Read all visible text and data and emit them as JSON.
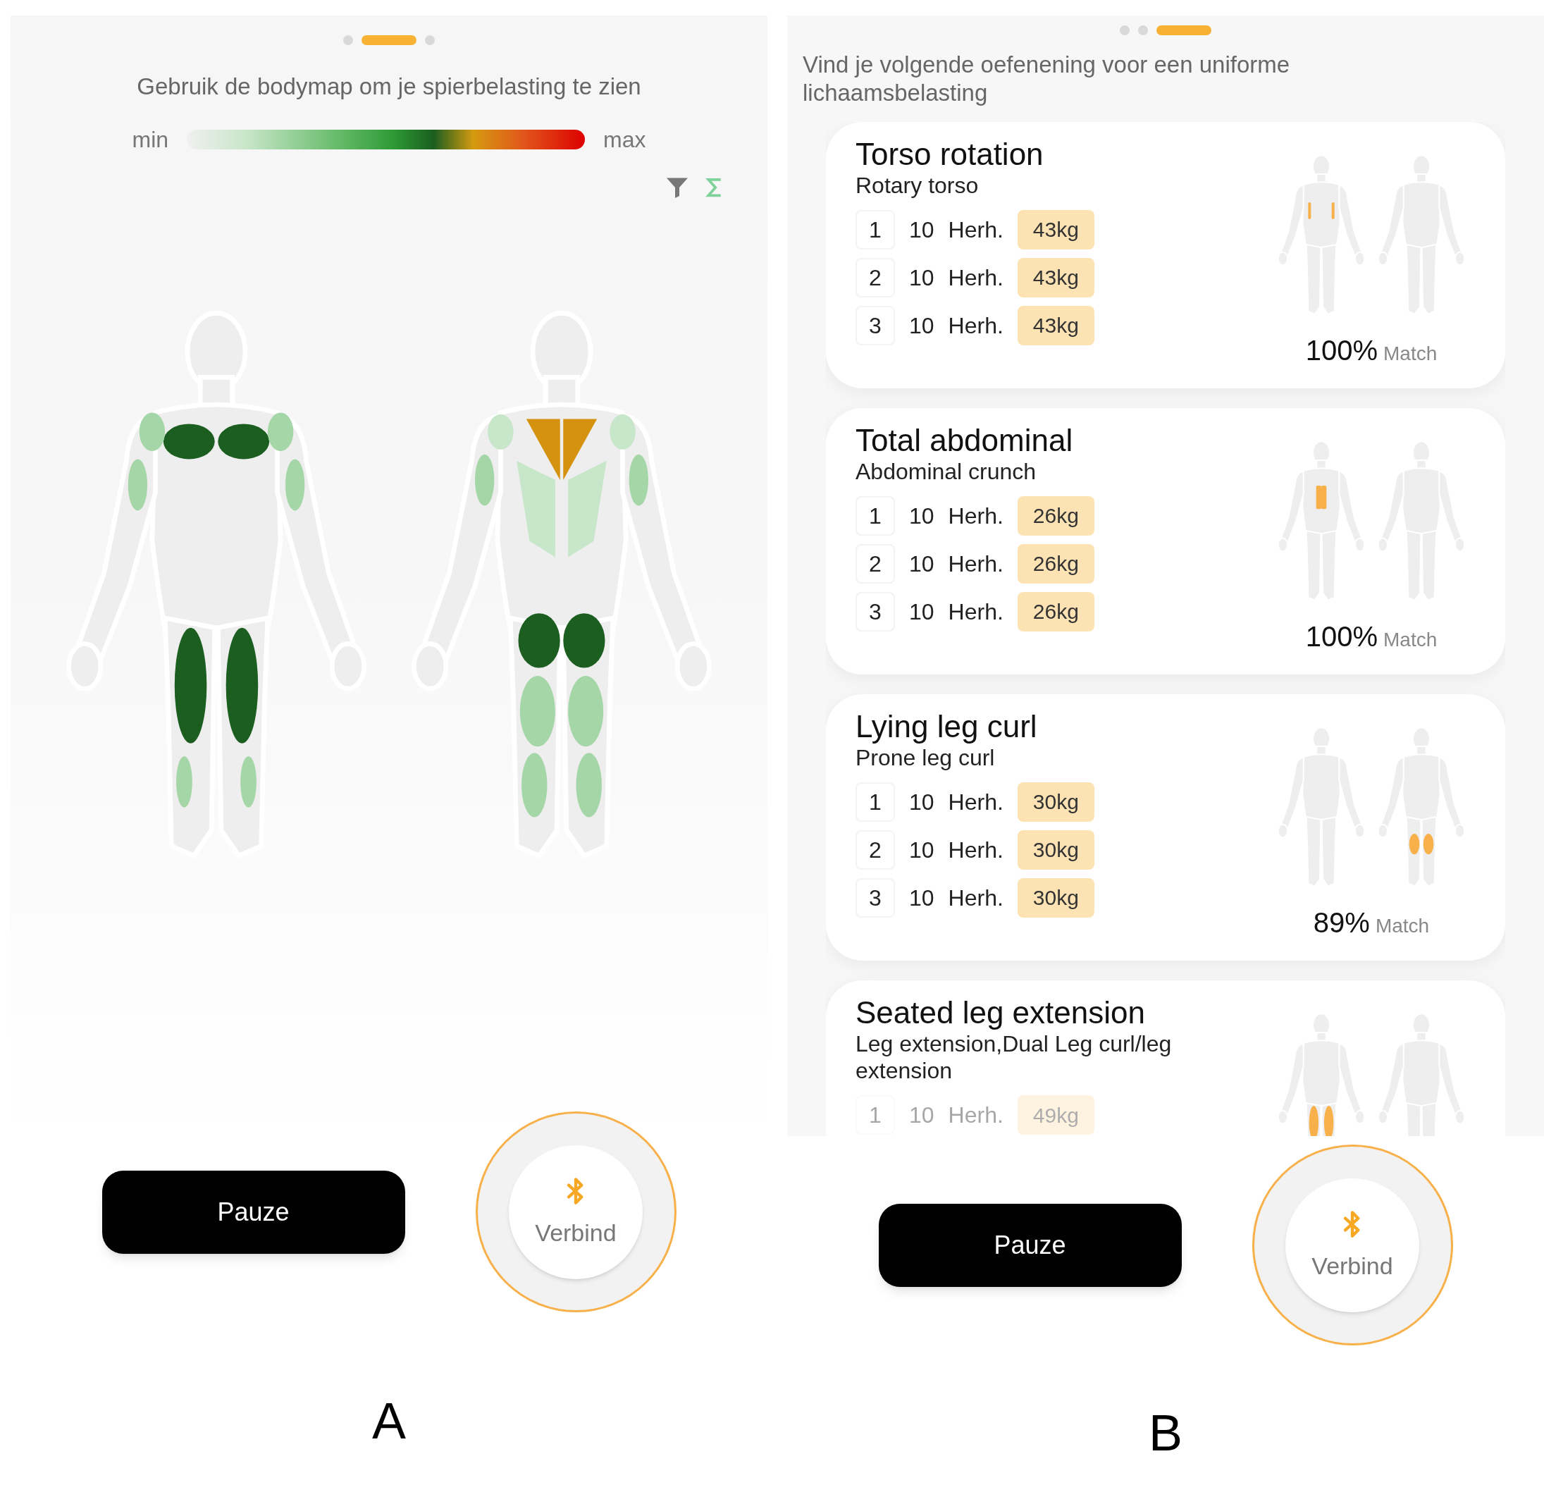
{
  "screens": [
    {
      "kind": "bodymap",
      "label": "A",
      "pager": [
        {
          "selected": false
        },
        {
          "selected": true
        },
        {
          "selected": false
        }
      ],
      "instruction": "Gebruik de bodymap om je spierbelasting te zien",
      "scale": {
        "min": "min",
        "max": "max"
      },
      "pause_button": "Pauze",
      "connect_button": "Verbind"
    },
    {
      "kind": "exercises",
      "label": "B",
      "pager": [
        {
          "selected": false
        },
        {
          "selected": false
        },
        {
          "selected": true
        }
      ],
      "instruction": "Vind je volgende oefenening voor een uniforme lichaamsbelasting",
      "exercises": [
        {
          "title": "Torso rotation",
          "subtitle": "Rotary torso",
          "kind": "obliques",
          "sets": [
            {
              "number": "1",
              "reps": "10",
              "unit": "Herh.",
              "weight": "43kg"
            },
            {
              "number": "2",
              "reps": "10",
              "unit": "Herh.",
              "weight": "43kg"
            },
            {
              "number": "3",
              "reps": "10",
              "unit": "Herh.",
              "weight": "43kg"
            }
          ],
          "match": "100%",
          "match_label": "Match"
        },
        {
          "title": "Total abdominal",
          "subtitle": "Abdominal crunch",
          "kind": "abs",
          "sets": [
            {
              "number": "1",
              "reps": "10",
              "unit": "Herh.",
              "weight": "26kg"
            },
            {
              "number": "2",
              "reps": "10",
              "unit": "Herh.",
              "weight": "26kg"
            },
            {
              "number": "3",
              "reps": "10",
              "unit": "Herh.",
              "weight": "26kg"
            }
          ],
          "match": "100%",
          "match_label": "Match"
        },
        {
          "title": "Lying leg curl",
          "subtitle": "Prone leg curl",
          "kind": "hamstrings",
          "sets": [
            {
              "number": "1",
              "reps": "10",
              "unit": "Herh.",
              "weight": "30kg"
            },
            {
              "number": "2",
              "reps": "10",
              "unit": "Herh.",
              "weight": "30kg"
            },
            {
              "number": "3",
              "reps": "10",
              "unit": "Herh.",
              "weight": "30kg"
            }
          ],
          "match": "89%",
          "match_label": "Match"
        },
        {
          "title": "Seated leg extension",
          "subtitle": "Leg extension,Dual Leg curl/leg extension",
          "kind": "quads",
          "sets": [
            {
              "number": "1",
              "reps": "10",
              "unit": "Herh.",
              "weight": "49kg"
            }
          ]
        }
      ],
      "pause_button": "Pauze",
      "connect_button": "Verbind"
    }
  ]
}
